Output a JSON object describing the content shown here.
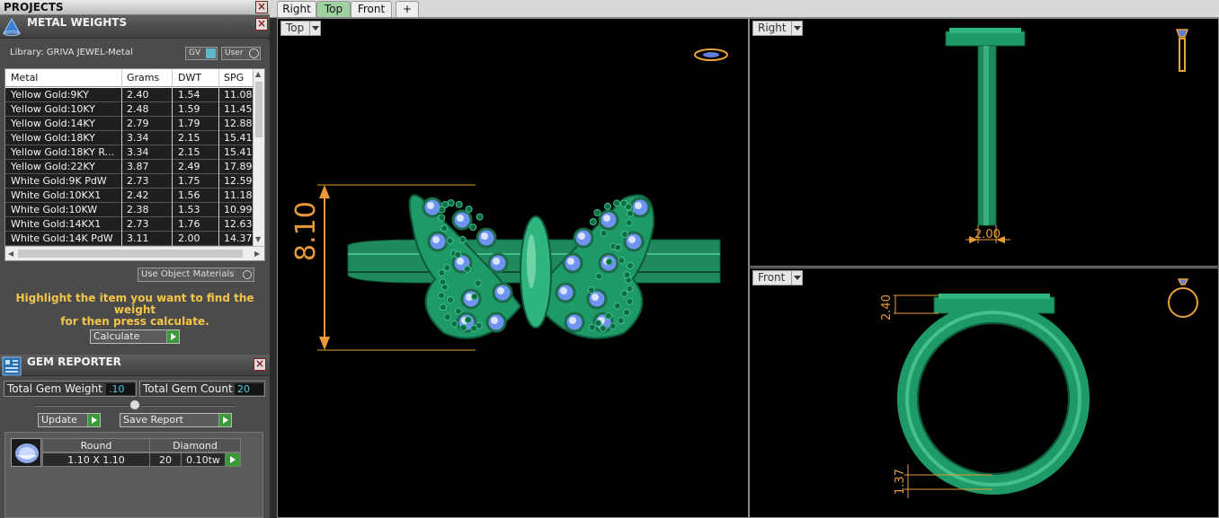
{
  "projects": {
    "title": "PROJECTS",
    "close": "×"
  },
  "metal_weights": {
    "title": "METAL WEIGHTS",
    "close": "×",
    "library": "Library: GRIVA JEWEL-Metal",
    "toggle_gv": "GV",
    "toggle_user": "User",
    "columns": [
      "Metal",
      "Grams",
      "DWT",
      "SPG"
    ],
    "rows": [
      [
        "Yellow Gold:9KY",
        "2.40",
        "1.54",
        "11.08"
      ],
      [
        "Yellow Gold:10KY",
        "2.48",
        "1.59",
        "11.45"
      ],
      [
        "Yellow Gold:14KY",
        "2.79",
        "1.79",
        "12.88"
      ],
      [
        "Yellow Gold:18KY",
        "3.34",
        "2.15",
        "15.41"
      ],
      [
        "Yellow Gold:18KY R...",
        "3.34",
        "2.15",
        "15.41"
      ],
      [
        "Yellow Gold:22KY",
        "3.87",
        "2.49",
        "17.89"
      ],
      [
        "White Gold:9K PdW",
        "2.73",
        "1.75",
        "12.59"
      ],
      [
        "White Gold:10KX1",
        "2.42",
        "1.56",
        "11.18"
      ],
      [
        "White Gold:10KW",
        "2.38",
        "1.53",
        "10.99"
      ],
      [
        "White Gold:14KX1",
        "2.73",
        "1.76",
        "12.63"
      ],
      [
        "White Gold:14K PdW",
        "3.11",
        "2.00",
        "14.37"
      ]
    ],
    "use_object_materials": "Use Object Materials",
    "hint_line1": "Highlight the item you want to find the weight",
    "hint_line2": "for then press calculate.",
    "calculate": "Calculate"
  },
  "gem_reporter": {
    "title": "GEM REPORTER",
    "close": "×",
    "total_weight_label": "Total Gem Weight",
    "total_weight_value": ".10",
    "total_count_label": "Total Gem Count",
    "total_count_value": "20",
    "update": "Update",
    "save_report": "Save Report",
    "gem": {
      "shape": "Round",
      "type": "Diamond",
      "size": "1.10 X 1.10",
      "count": "20",
      "weight": "0.10tw"
    }
  },
  "tabs": [
    "Right",
    "Top",
    "Front",
    "+"
  ],
  "active_tab": "Top",
  "viewports": {
    "top": {
      "label": "Top",
      "dimension": "8.10"
    },
    "right": {
      "label": "Right",
      "dimension": "2.00"
    },
    "front": {
      "label": "Front",
      "dimension_top": "2.40",
      "dimension_bottom": "1.37"
    }
  },
  "colors": {
    "ring_green": "#1f9a66",
    "dim_orange": "#e89a3a",
    "gem_blue": "#7fa7ff"
  }
}
